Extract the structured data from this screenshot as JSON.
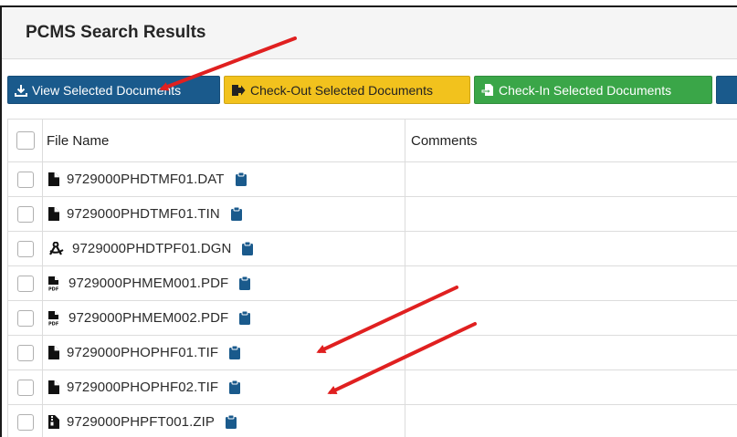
{
  "page": {
    "title": "PCMS Search Results"
  },
  "toolbar": {
    "view_label": "View Selected Documents",
    "checkout_label": "Check-Out Selected Documents",
    "checkin_label": "Check-In Selected Documents"
  },
  "table": {
    "columns": [
      "File Name",
      "Comments"
    ],
    "rows": [
      {
        "file_name": "9729000PHDTMF01.DAT",
        "icon": "file-icon",
        "comments": ""
      },
      {
        "file_name": "9729000PHDTMF01.TIN",
        "icon": "file-icon",
        "comments": ""
      },
      {
        "file_name": "9729000PHDTPF01.DGN",
        "icon": "drafting-compass-icon",
        "comments": ""
      },
      {
        "file_name": "9729000PHMEM001.PDF",
        "icon": "pdf-file-icon",
        "comments": ""
      },
      {
        "file_name": "9729000PHMEM002.PDF",
        "icon": "pdf-file-icon",
        "comments": ""
      },
      {
        "file_name": "9729000PHOPHF01.TIF",
        "icon": "file-icon",
        "comments": ""
      },
      {
        "file_name": "9729000PHOPHF02.TIF",
        "icon": "file-icon",
        "comments": ""
      },
      {
        "file_name": "9729000PHPFT001.ZIP",
        "icon": "zip-file-icon",
        "comments": ""
      }
    ]
  },
  "colors": {
    "view_button": "#1a5a8c",
    "checkout_button": "#f2c21d",
    "checkin_button": "#3aa648",
    "clipboard_icon": "#1a5a8c",
    "annotation_arrow": "#e02020"
  }
}
